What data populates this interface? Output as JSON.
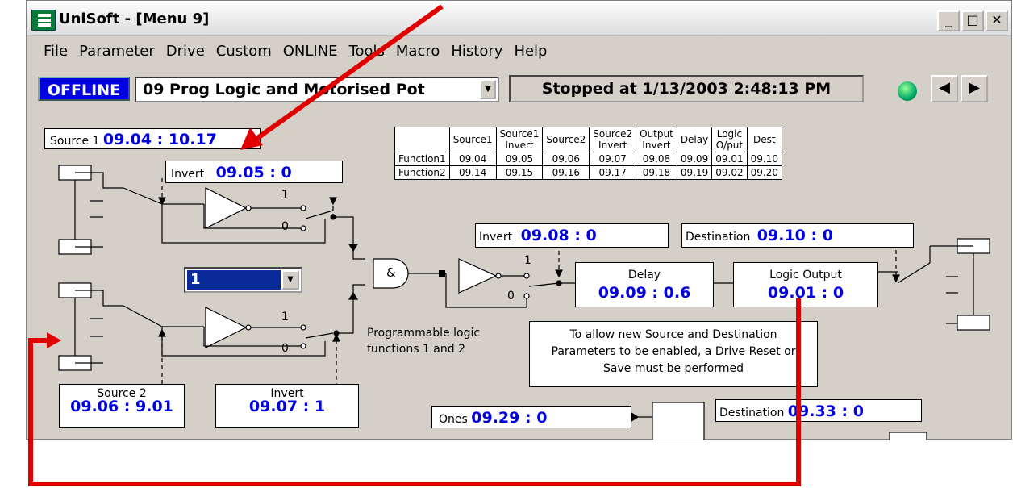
{
  "window": {
    "title": "UniSoft - [Menu 9]",
    "minimize": "_",
    "maximize": "□",
    "close": "✕"
  },
  "menu": [
    "File",
    "Parameter",
    "Drive",
    "Custom",
    "ONLINE",
    "Tools",
    "Macro",
    "History",
    "Help"
  ],
  "toolbar": {
    "mode": "OFFLINE",
    "menu_select": "09 Prog Logic and Motorised Pot",
    "status": "Stopped at 1/13/2003 2:48:13 PM",
    "prev_icon": "◀",
    "next_icon": "▶"
  },
  "diagram": {
    "source1": {
      "label": "Source 1",
      "value": "09.04 : 10.17"
    },
    "invert1": {
      "label": "Invert",
      "value": "09.05 : 0"
    },
    "source2": {
      "label": "Source 2",
      "value": "09.06 : 9.01"
    },
    "invert2": {
      "label": "Invert",
      "value": "09.07 : 1"
    },
    "invert_out": {
      "label": "Invert",
      "value": "09.08 : 0"
    },
    "destination1": {
      "label": "Destination",
      "value": "09.10 : 0"
    },
    "delay": {
      "label": "Delay",
      "value": "09.09 : 0.6"
    },
    "logic_output": {
      "label": "Logic Output",
      "value": "09.01 : 0"
    },
    "function_select": "1",
    "and_symbol": "&",
    "switch_1": "1",
    "switch_0": "0",
    "prog_logic_text": [
      "Programmable logic",
      "functions 1 and 2"
    ],
    "note": [
      "To allow new Source and Destination",
      "Parameters to be enabled, a Drive Reset or",
      "Save must be performed"
    ],
    "ones": {
      "label": "Ones",
      "value": "09.29 : 0"
    },
    "destination2": {
      "label": "Destination",
      "value": "09.33 : 0"
    },
    "table": {
      "headers": [
        [
          "",
          ""
        ],
        [
          "Source1",
          ""
        ],
        [
          "Source1",
          "Invert"
        ],
        [
          "Source2",
          ""
        ],
        [
          "Source2",
          "Invert"
        ],
        [
          "Output",
          "Invert"
        ],
        [
          "Delay",
          ""
        ],
        [
          "Logic",
          "O/put"
        ],
        [
          "Dest",
          ""
        ]
      ],
      "rows": [
        [
          "Function1",
          "09.04",
          "09.05",
          "09.06",
          "09.07",
          "09.08",
          "09.09",
          "09.01",
          "09.10"
        ],
        [
          "Function2",
          "09.14",
          "09.15",
          "09.16",
          "09.17",
          "09.18",
          "09.19",
          "09.02",
          "09.20"
        ]
      ]
    }
  },
  "colors": {
    "annotation": "#e00000",
    "value_blue": "#0000e0",
    "offline_bg": "#0000e0"
  }
}
